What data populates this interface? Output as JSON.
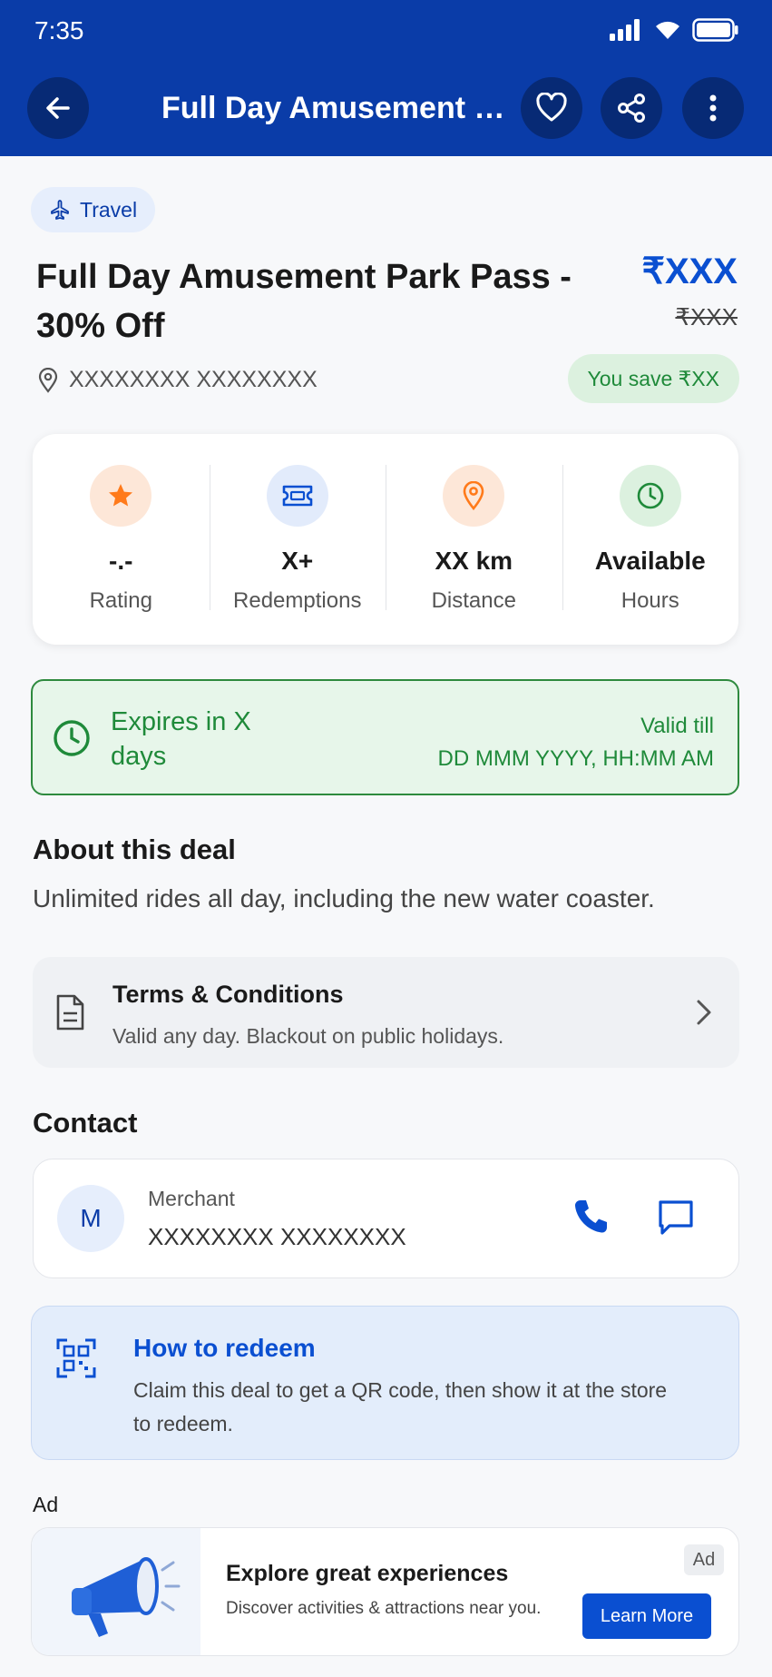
{
  "status_bar": {
    "time": "7:35"
  },
  "header": {
    "title": "Full Day Amusement P..."
  },
  "deal": {
    "category": "Travel",
    "title": "Full Day Amusement Park Pass - 30% Off",
    "price": "₹XXX",
    "original_price": "₹XXX",
    "location": "XXXXXXXX XXXXXXXX",
    "savings": "You save ₹XX"
  },
  "stats": [
    {
      "value": "-.-",
      "label": "Rating",
      "icon": "star-icon",
      "color": "#ff7a1a"
    },
    {
      "value": "X+",
      "label": "Redemptions",
      "icon": "ticket-icon",
      "color": "#0a4fd1"
    },
    {
      "value": "XX km",
      "label": "Distance",
      "icon": "location-pin-icon",
      "color": "#ff7a1a"
    },
    {
      "value": "Available",
      "label": "Hours",
      "icon": "clock-icon",
      "color": "#1f8a3a"
    }
  ],
  "expiry": {
    "title": "Expires in X days",
    "valid_label": "Valid till",
    "valid_value": "DD MMM YYYY, HH:MM AM"
  },
  "about": {
    "heading": "About this deal",
    "text": "Unlimited rides all day, including the new water coaster."
  },
  "terms": {
    "title": "Terms & Conditions",
    "subtitle": "Valid any day. Blackout on public holidays."
  },
  "contact": {
    "heading": "Contact",
    "avatar_initial": "M",
    "merchant_label": "Merchant",
    "merchant_name": "XXXXXXXX XXXXXXXX"
  },
  "redeem": {
    "title": "How to redeem",
    "text": "Claim this deal to get a QR code, then show it at the store to redeem."
  },
  "ad": {
    "section_label": "Ad",
    "title": "Explore great experiences",
    "subtitle": "Discover activities & attractions near you.",
    "badge": "Ad",
    "cta": "Learn More"
  },
  "colors": {
    "brand": "#0a3ca8",
    "accent": "#0a4fd1",
    "success": "#1f8a3a",
    "orange": "#ff7a1a"
  }
}
